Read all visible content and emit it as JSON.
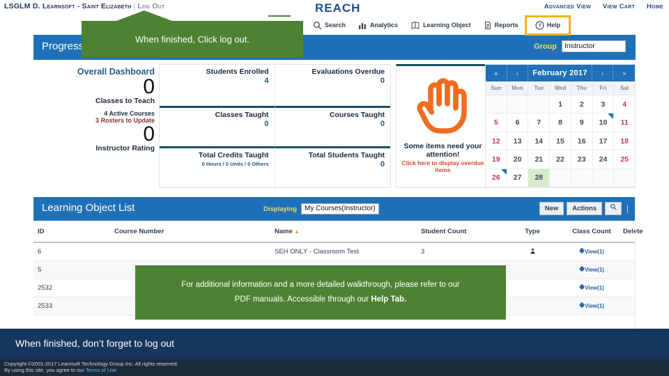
{
  "topbar": {
    "account": "LSGLM D. Learnsoft - Saint Elizabeth",
    "separator": "|",
    "logout": "Log Out",
    "right_links": [
      "Advanced View",
      "View Cart",
      "Home"
    ]
  },
  "brand": "REACH",
  "nav": [
    {
      "label": "Search",
      "icon": "search-icon"
    },
    {
      "label": "Analytics",
      "icon": "bar-chart-icon"
    },
    {
      "label": "Learning Object",
      "icon": "book-icon"
    },
    {
      "label": "Reports",
      "icon": "document-icon"
    },
    {
      "label": "Help",
      "icon": "question-circle-icon"
    }
  ],
  "progress_bar": {
    "title": "Progress",
    "group_label": "Group",
    "group_value": "Instructor"
  },
  "dashboard": {
    "header": "Overall Dashboard",
    "classes_to_teach_value": "0",
    "classes_to_teach_label": "Classes to Teach",
    "active_courses": "4 Active Courses",
    "rosters_to_update": "3 Rosters to Update",
    "instructor_rating_value": "0",
    "instructor_rating_label": "Instructor Rating",
    "cards": [
      {
        "label": "Students Enrolled",
        "value": "4",
        "small": false
      },
      {
        "label": "Evaluations Overdue",
        "value": "0",
        "small": false
      },
      {
        "label": "Classes Taught",
        "value": "0",
        "small": false
      },
      {
        "label": "Courses Taught",
        "value": "0",
        "small": false
      },
      {
        "label": "Total Credits Taught",
        "value": "0 Hours / 0 Units / 0 Others",
        "small": true
      },
      {
        "label": "Total Students Taught",
        "value": "0",
        "small": false
      }
    ],
    "attention": {
      "icon": "hand-stop-icon",
      "line1": "Some items need your attention!",
      "line2": "Click here to display overdue items"
    }
  },
  "calendar": {
    "nav_first": "«",
    "nav_prev": "‹",
    "month": "February",
    "year": "2017",
    "nav_next": "›",
    "nav_last": "»",
    "dow": [
      "Sun",
      "Mon",
      "Tue",
      "Wed",
      "Thu",
      "Fri",
      "Sat"
    ],
    "weeks": [
      [
        {
          "d": "",
          "blank": true
        },
        {
          "d": "",
          "blank": true
        },
        {
          "d": "",
          "blank": true
        },
        {
          "d": "1"
        },
        {
          "d": "2"
        },
        {
          "d": "3"
        },
        {
          "d": "4",
          "we": true
        }
      ],
      [
        {
          "d": "5",
          "we": true
        },
        {
          "d": "6"
        },
        {
          "d": "7"
        },
        {
          "d": "8"
        },
        {
          "d": "9"
        },
        {
          "d": "10",
          "flag": true
        },
        {
          "d": "11",
          "we": true
        }
      ],
      [
        {
          "d": "12",
          "we": true
        },
        {
          "d": "13"
        },
        {
          "d": "14"
        },
        {
          "d": "15"
        },
        {
          "d": "16"
        },
        {
          "d": "17"
        },
        {
          "d": "18",
          "we": true
        }
      ],
      [
        {
          "d": "19",
          "we": true
        },
        {
          "d": "20"
        },
        {
          "d": "21"
        },
        {
          "d": "22"
        },
        {
          "d": "23"
        },
        {
          "d": "24"
        },
        {
          "d": "25",
          "we": true
        }
      ],
      [
        {
          "d": "26",
          "we": true,
          "flag": true
        },
        {
          "d": "27"
        },
        {
          "d": "28",
          "sel": true
        },
        {
          "d": "",
          "blank": true
        },
        {
          "d": "",
          "blank": true
        },
        {
          "d": "",
          "blank": true
        },
        {
          "d": "",
          "blank": true
        }
      ]
    ]
  },
  "learning_object_list": {
    "title": "Learning Object List",
    "displaying_label": "Displaying",
    "displaying_value": "My Courses(Instructor)",
    "new_label": "New",
    "actions_label": "Actions",
    "search_icon": "magnifier-icon",
    "columns": [
      "ID",
      "Course Number",
      "Name",
      "Student Count",
      "Type",
      "Class Count",
      "Delete"
    ],
    "sort_column": "Name",
    "rows": [
      {
        "id": "6",
        "course_number": "",
        "name": "SEH ONLY - Classroom Test",
        "student_count": "3",
        "type": "person-icon",
        "class_count": "View(1)",
        "delete": ""
      },
      {
        "id": "5",
        "course_number": "",
        "name": "",
        "student_count": "",
        "type": "",
        "class_count": "View(1)",
        "delete": ""
      },
      {
        "id": "2532",
        "course_number": "",
        "name": "",
        "student_count": "",
        "type": "",
        "class_count": "View(1)",
        "delete": ""
      },
      {
        "id": "2533",
        "course_number": "",
        "name": "",
        "student_count": "",
        "type": "",
        "class_count": "View(1)",
        "delete": ""
      }
    ]
  },
  "callouts": {
    "top": "When finished, Click log out.",
    "middle_line1": "For additional information and a more detailed walkthrough, please refer to our",
    "middle_line2_pre": "PDF manuals. Accessible through our ",
    "middle_line2_bold": "Help Tab."
  },
  "bottom_banner": "When finished, don’t forget to log out",
  "footer": {
    "line1": "Copyright ©2001-2017 Learnsoft Technology Group Inc. All rights reserved.",
    "line2_pre": "By using this site, you agree to our ",
    "line2_link": "Terms of Use"
  },
  "colors": {
    "blue": "#1e71b8",
    "dark_blue": "#17365d",
    "green_callout": "#4d8232",
    "yellow_highlight": "#f0b41f",
    "orange": "#ef6c20",
    "red_text": "#8f2d2d"
  }
}
